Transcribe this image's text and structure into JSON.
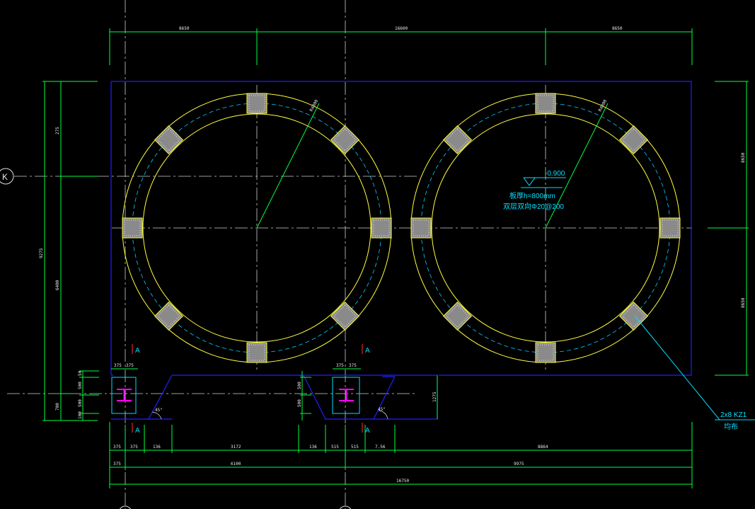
{
  "palette": {
    "background": "#000000",
    "outline": "#2020ff",
    "ring": "#ffff40",
    "centerline": "#c8c8c8",
    "dimension": "#00ff40",
    "rebar": "#00e0ff",
    "column_fill": "#bcbcbc",
    "steel": "#ff00ff",
    "section": "#ff3030"
  },
  "axis_bubble": {
    "label": "K"
  },
  "dimensions_top": {
    "left": "8650",
    "middle": "16600",
    "right": "8650"
  },
  "dimensions_left": {
    "top": "275",
    "middle": "6400",
    "overall": "9275",
    "bottom": "700"
  },
  "dimensions_right": {
    "upper": "8650",
    "lower": "8650"
  },
  "dimensions_bottom_row1": [
    "375",
    "375",
    "136",
    "3172",
    "136",
    "515",
    "515",
    "7.56",
    "8864"
  ],
  "dimensions_bottom_row2": {
    "a": "375",
    "b": "6100",
    "c": "9975"
  },
  "dimensions_bottom_overall": "16750",
  "pit_dims": {
    "top_a": "375",
    "top_b": "375",
    "side": [
      "50",
      "500",
      "500",
      "100"
    ],
    "right": "1275"
  },
  "radius_labels": {
    "left": "R4000",
    "right": "R4000"
  },
  "elevation": {
    "value": "-0.900"
  },
  "slab_note": {
    "line1": "板厚h=800mm",
    "line2": "双层双向Φ20@200"
  },
  "column_note": {
    "line1": "2x8 KZ1",
    "line2": "均布"
  },
  "section_marks": {
    "label": "A"
  },
  "angle_label": "45°"
}
